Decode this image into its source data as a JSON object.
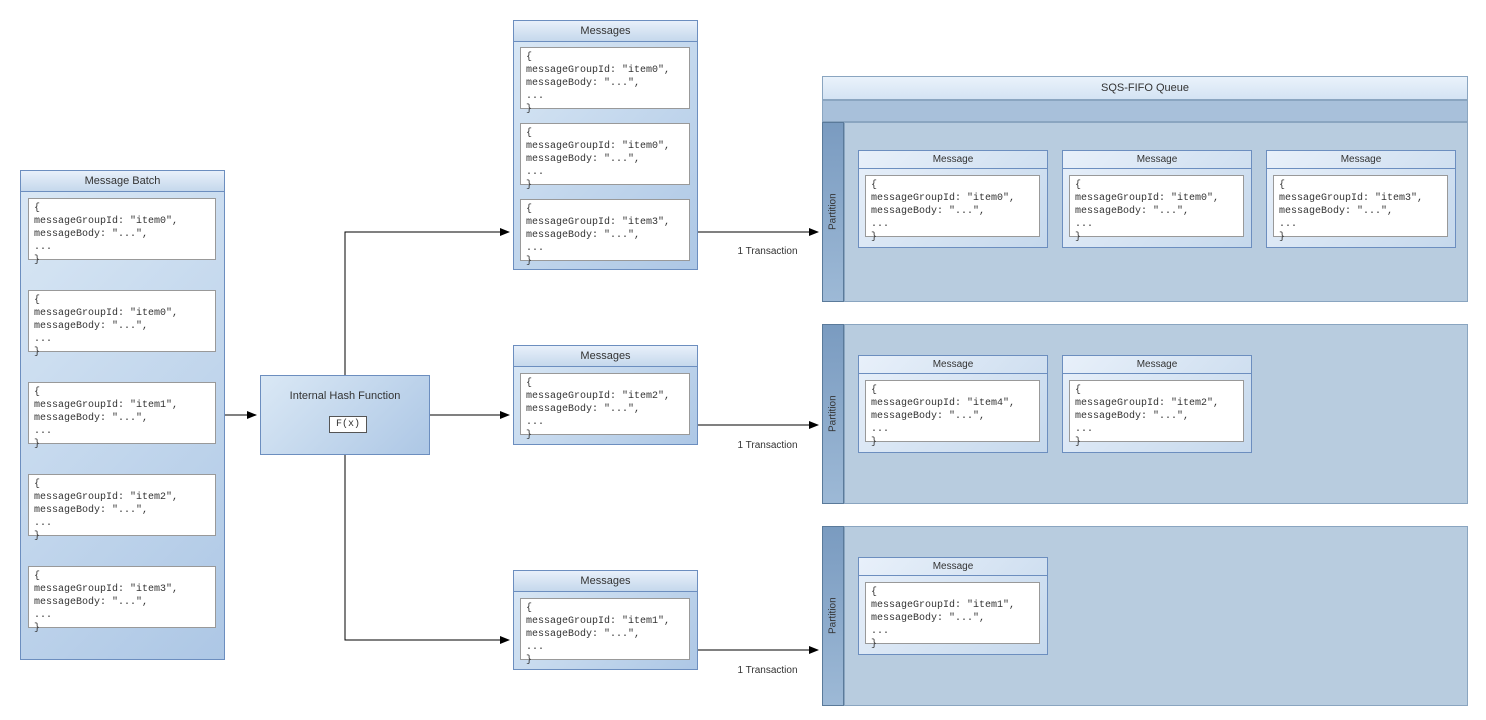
{
  "messageBatch": {
    "title": "Message Batch",
    "items": [
      {
        "groupId": "item0"
      },
      {
        "groupId": "item0"
      },
      {
        "groupId": "item1"
      },
      {
        "groupId": "item2"
      },
      {
        "groupId": "item3"
      }
    ]
  },
  "hashFunction": {
    "title": "Internal Hash Function",
    "fx": "F(x)"
  },
  "messagesGroups": [
    {
      "title": "Messages",
      "items": [
        {
          "groupId": "item0"
        },
        {
          "groupId": "item0"
        },
        {
          "groupId": "item3"
        }
      ],
      "txn": "1 Transaction"
    },
    {
      "title": "Messages",
      "items": [
        {
          "groupId": "item2"
        }
      ],
      "txn": "1 Transaction"
    },
    {
      "title": "Messages",
      "items": [
        {
          "groupId": "item1"
        }
      ],
      "txn": "1 Transaction"
    }
  ],
  "queue": {
    "title": "SQS-FIFO Queue",
    "partitions": [
      {
        "label": "Partition",
        "messages": [
          {
            "title": "Message",
            "groupId": "item0"
          },
          {
            "title": "Message",
            "groupId": "item0"
          },
          {
            "title": "Message",
            "groupId": "item3"
          }
        ]
      },
      {
        "label": "Partition",
        "messages": [
          {
            "title": "Message",
            "groupId": "item4"
          },
          {
            "title": "Message",
            "groupId": "item2"
          }
        ]
      },
      {
        "label": "Partition",
        "messages": [
          {
            "title": "Message",
            "groupId": "item1"
          }
        ]
      }
    ]
  },
  "msgTemplate": {
    "prefix": "{\nmessageGroupId: \"",
    "suffix": "\",\nmessageBody: \"...\",\n...\n}"
  }
}
